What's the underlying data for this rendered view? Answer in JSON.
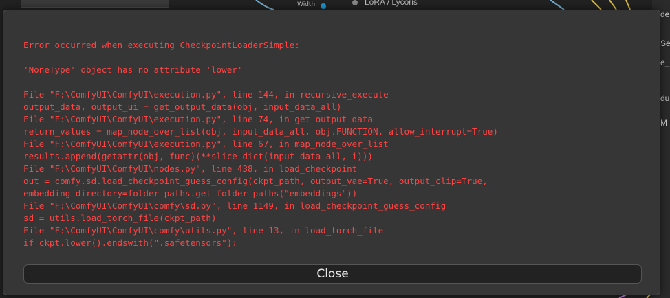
{
  "background": {
    "node_widget_label": "Width",
    "node_title": "LoRA / Lycoris",
    "right_panel_fragments": [
      "de",
      "Sele",
      "e_",
      "dua",
      "M"
    ]
  },
  "error_dialog": {
    "lines": [
      "Error occurred when executing CheckpointLoaderSimple:",
      "",
      "'NoneType' object has no attribute 'lower'",
      "",
      "File \"F:\\ComfyUI\\ComfyUI\\execution.py\", line 144, in recursive_execute",
      "output_data, output_ui = get_output_data(obj, input_data_all)",
      "File \"F:\\ComfyUI\\ComfyUI\\execution.py\", line 74, in get_output_data",
      "return_values = map_node_over_list(obj, input_data_all, obj.FUNCTION, allow_interrupt=True)",
      "File \"F:\\ComfyUI\\ComfyUI\\execution.py\", line 67, in map_node_over_list",
      "results.append(getattr(obj, func)(**slice_dict(input_data_all, i)))",
      "File \"F:\\ComfyUI\\ComfyUI\\nodes.py\", line 438, in load_checkpoint",
      "out = comfy.sd.load_checkpoint_guess_config(ckpt_path, output_vae=True, output_clip=True,",
      "embedding_directory=folder_paths.get_folder_paths(\"embeddings\"))",
      "File \"F:\\ComfyUI\\ComfyUI\\comfy\\sd.py\", line 1149, in load_checkpoint_guess_config",
      "sd = utils.load_torch_file(ckpt_path)",
      "File \"F:\\ComfyUI\\ComfyUI\\comfy\\utils.py\", line 13, in load_torch_file",
      "if ckpt.lower().endswith(\".safetensors\"):"
    ],
    "close_label": "Close",
    "text_color": "#ff4444",
    "background_color": "#363636"
  }
}
